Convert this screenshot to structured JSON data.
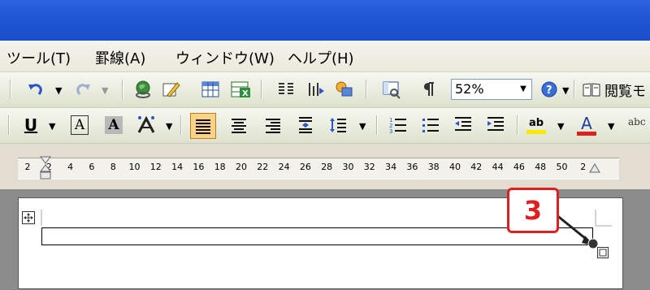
{
  "menu": {
    "items": [
      {
        "label": "ツール(T)"
      },
      {
        "label": "罫線(A)"
      },
      {
        "label": "ウィンドウ(W)"
      },
      {
        "label": "ヘルプ(H)"
      }
    ]
  },
  "toolbar_standard": {
    "zoom_value": "52%",
    "read_label": "閲覧モ"
  },
  "toolbar_format": {
    "underline_letter": "U",
    "char_border_letter": "A",
    "char_shading_letter": "A",
    "font_color_letter": "A",
    "highlight_letters": "ab",
    "more_letters": "abc"
  },
  "ruler": {
    "ticks": [
      "2",
      "2",
      "4",
      "6",
      "8",
      "10",
      "12",
      "14",
      "16",
      "18",
      "20",
      "22",
      "24",
      "26",
      "28",
      "30",
      "32",
      "34",
      "36",
      "38",
      "40",
      "42",
      "44",
      "46",
      "48",
      "50",
      "2"
    ]
  },
  "callout": {
    "number": "3"
  },
  "colors": {
    "accent_red": "#e02020",
    "highlight_yellow": "#f7e900",
    "font_red": "#e0201a",
    "title_blue": "#1f57d6"
  }
}
